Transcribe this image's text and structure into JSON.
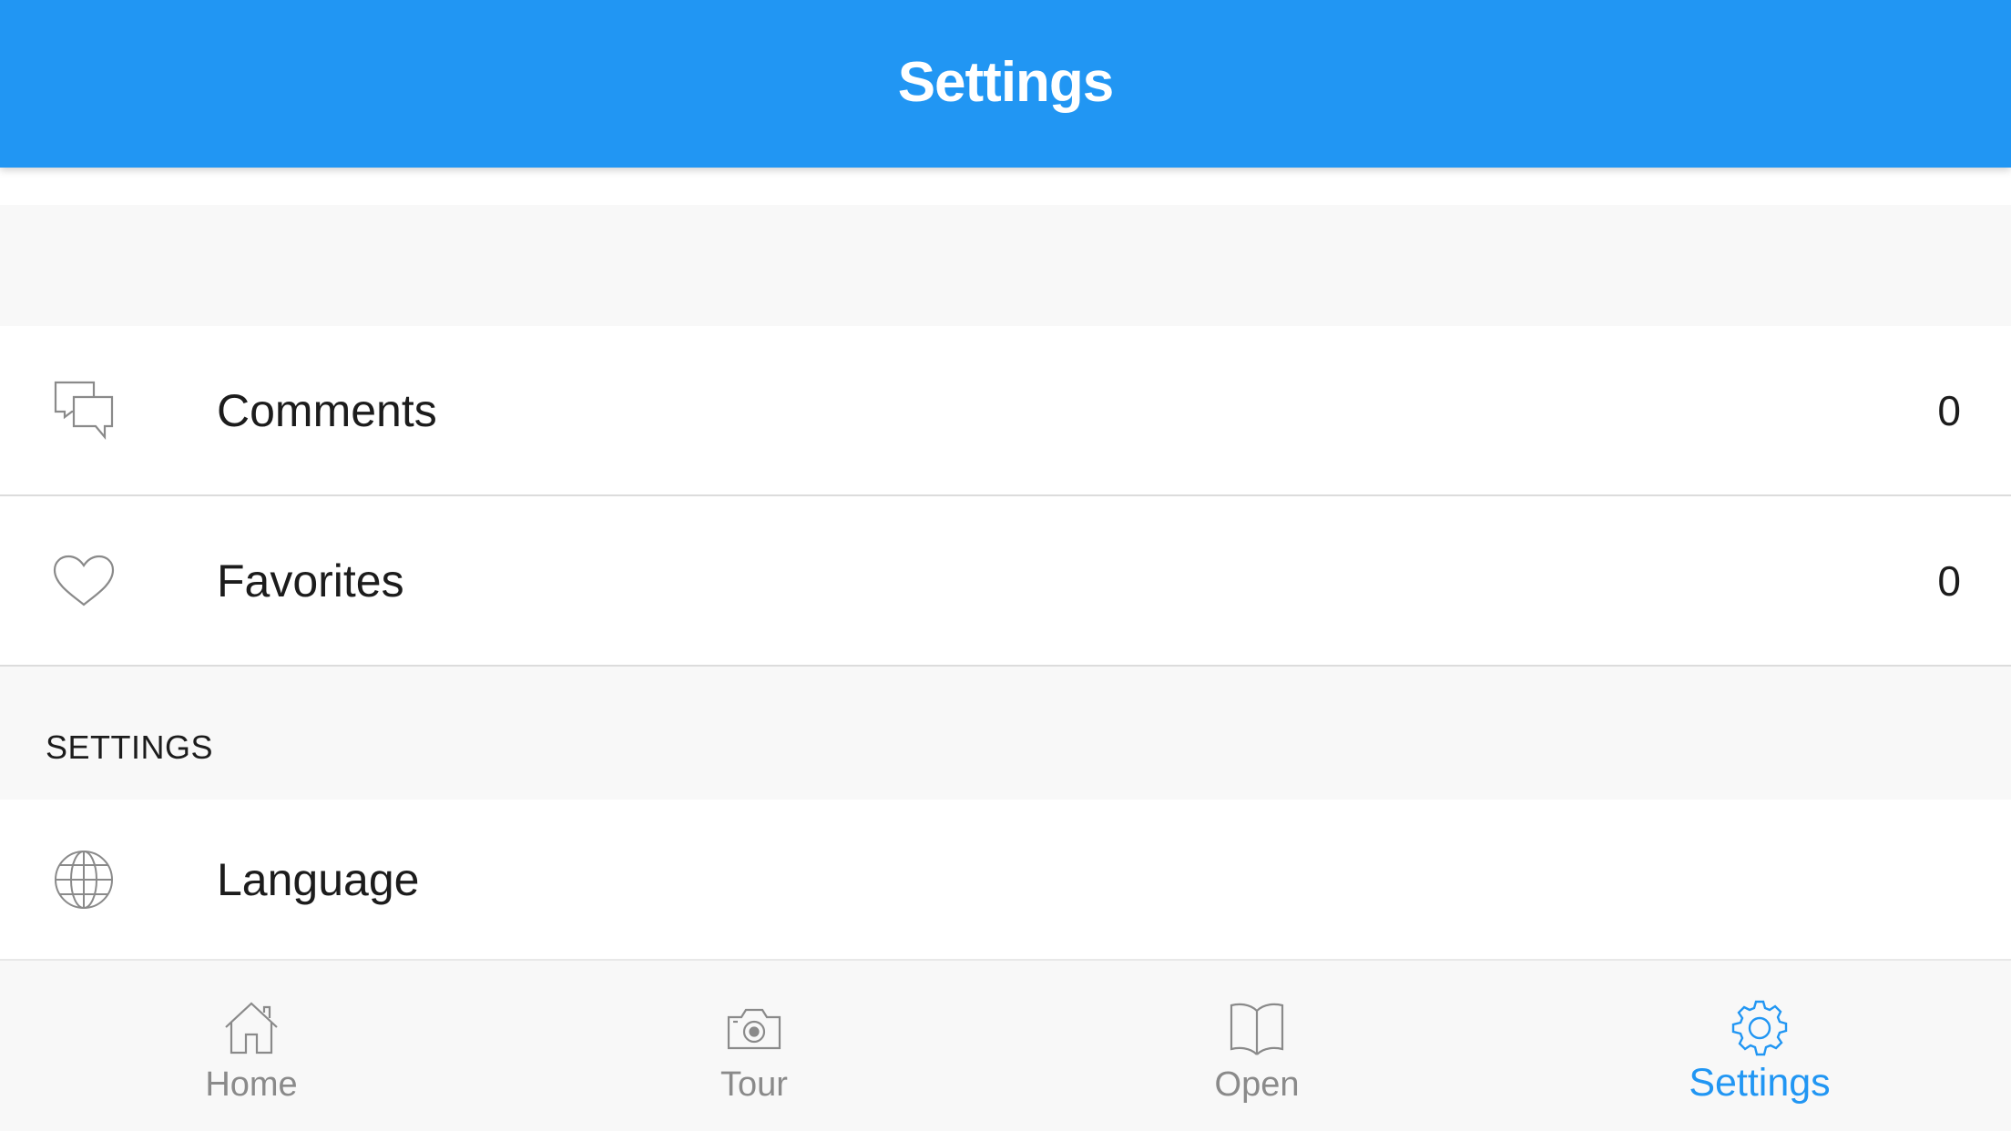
{
  "header": {
    "title": "Settings"
  },
  "rows": {
    "comments": {
      "label": "Comments",
      "value": "0",
      "icon": "comments-icon"
    },
    "favorites": {
      "label": "Favorites",
      "value": "0",
      "icon": "heart-icon"
    },
    "language": {
      "label": "Language",
      "icon": "globe-icon"
    }
  },
  "sections": {
    "settings_header": "SETTINGS"
  },
  "tabbar": {
    "tabs": [
      {
        "label": "Home",
        "icon": "home-icon",
        "active": false
      },
      {
        "label": "Tour",
        "icon": "camera-icon",
        "active": false
      },
      {
        "label": "Open",
        "icon": "book-icon",
        "active": false
      },
      {
        "label": "Settings",
        "icon": "gear-icon",
        "active": true
      }
    ]
  },
  "colors": {
    "accent": "#2196f3",
    "icon_gray": "#8a8a8a",
    "section_bg": "#f8f8f8"
  }
}
